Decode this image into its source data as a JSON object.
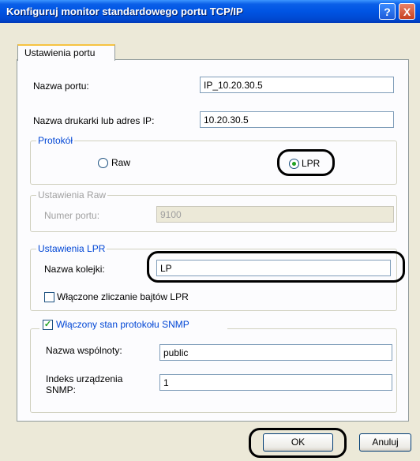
{
  "window": {
    "title": "Konfiguruj monitor standardowego portu TCP/IP",
    "help_glyph": "?",
    "close_glyph": "X"
  },
  "tabs": [
    {
      "label": "Ustawienia portu"
    }
  ],
  "port_name": {
    "label": "Nazwa portu:",
    "value": "IP_10.20.30.5"
  },
  "printer_address": {
    "label": "Nazwa drukarki lub adres IP:",
    "value": "10.20.30.5"
  },
  "protocol": {
    "legend": "Protokół",
    "raw_label": "Raw",
    "lpr_label": "LPR",
    "selected": "LPR"
  },
  "raw_settings": {
    "legend": "Ustawienia Raw",
    "port_number_label": "Numer portu:",
    "port_number_value": "9100"
  },
  "lpr_settings": {
    "legend": "Ustawienia LPR",
    "queue_label": "Nazwa kolejki:",
    "queue_value": "LP",
    "byte_count_label": "Włączone zliczanie bajtów LPR",
    "byte_count_checked": false
  },
  "snmp": {
    "legend": "Włączony stan protokołu SNMP",
    "enabled": true,
    "community_label": "Nazwa wspólnoty:",
    "community_value": "public",
    "device_index_label_1": "Indeks urządzenia",
    "device_index_label_2": "SNMP:",
    "device_index_value": "1"
  },
  "buttons": {
    "ok": "OK",
    "cancel": "Anuluj"
  },
  "colors": {
    "titlebar": "#0054E3",
    "dialog": "#ECE9D8",
    "group_legend": "#0046D5",
    "check": "#21A121"
  },
  "icons": [
    "help-icon",
    "close-icon",
    "radio-icon",
    "checkbox-icon"
  ]
}
